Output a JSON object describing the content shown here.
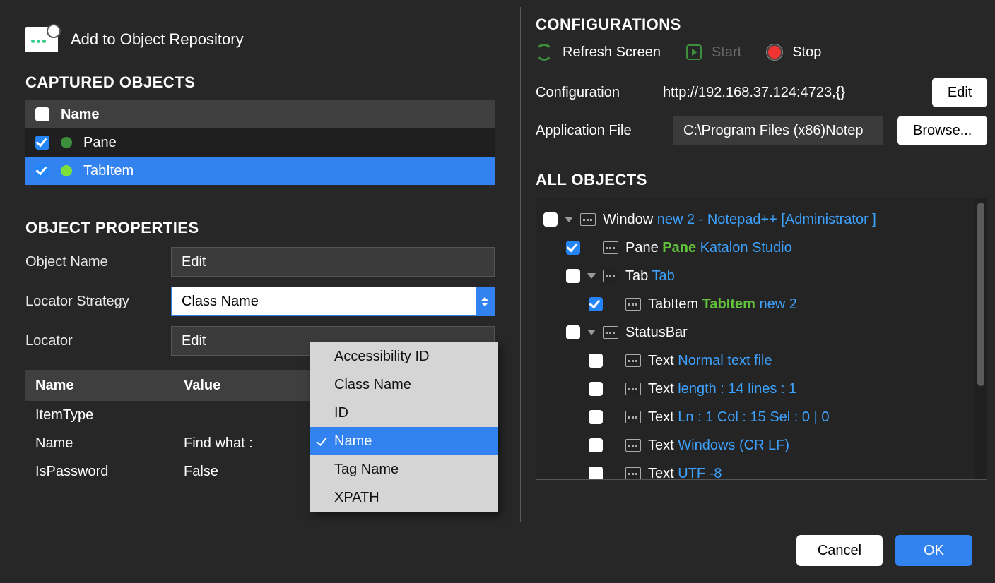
{
  "title": "Add to Object Repository",
  "captured": {
    "heading": "CAPTURED OBJECTS",
    "column": "Name",
    "rows": [
      {
        "label": "Pane"
      },
      {
        "label": "TabItem"
      }
    ]
  },
  "props": {
    "heading": "OBJECT PROPERTIES",
    "objectNameLabel": "Object Name",
    "objectNameValue": "Edit",
    "locatorStrategyLabel": "Locator Strategy",
    "locatorStrategyValue": "Class Name",
    "locatorLabel": "Locator",
    "locatorValue": "Edit",
    "table": {
      "h1": "Name",
      "h2": "Value",
      "rows": [
        {
          "name": "ItemType",
          "value": ""
        },
        {
          "name": "Name",
          "value": "Find what :"
        },
        {
          "name": "IsPassword",
          "value": "False"
        }
      ]
    }
  },
  "dropdown": {
    "items": [
      "Accessibility ID",
      "Class Name",
      "ID",
      "Name",
      "Tag Name",
      "XPATH"
    ],
    "selected": "Name"
  },
  "config": {
    "heading": "CONFIGURATIONS",
    "refresh": "Refresh Screen",
    "start": "Start",
    "stop": "Stop",
    "configurationLabel": "Configuration",
    "configurationValue": "http://192.168.37.124:4723,{}",
    "editBtn": "Edit",
    "appFileLabel": "Application File",
    "appFileValue": "C:\\Program Files (x86)Notep",
    "browseBtn": "Browse..."
  },
  "all": {
    "heading": "ALL OBJECTS",
    "tree": [
      {
        "indent": 0,
        "checked": false,
        "exp": "open",
        "type": "Window",
        "green": "",
        "blue": "new 2 - Notepad++ [Administrator ]"
      },
      {
        "indent": 1,
        "checked": true,
        "exp": "",
        "type": "Pane",
        "green": "Pane",
        "blue": "Katalon Studio"
      },
      {
        "indent": 1,
        "checked": false,
        "exp": "open",
        "type": "Tab",
        "green": "",
        "blue": "Tab"
      },
      {
        "indent": 2,
        "checked": true,
        "exp": "",
        "type": "TabItem",
        "green": "TabItem",
        "blue": "new 2"
      },
      {
        "indent": 1,
        "checked": false,
        "exp": "open",
        "type": "StatusBar",
        "green": "",
        "blue": ""
      },
      {
        "indent": 2,
        "checked": false,
        "exp": "",
        "type": "Text",
        "green": "",
        "blue": "Normal text file"
      },
      {
        "indent": 2,
        "checked": false,
        "exp": "",
        "type": "Text",
        "green": "",
        "blue": "length : 14  lines : 1"
      },
      {
        "indent": 2,
        "checked": false,
        "exp": "",
        "type": "Text",
        "green": "",
        "blue": "Ln : 1  Col : 15   Sel : 0 | 0"
      },
      {
        "indent": 2,
        "checked": false,
        "exp": "",
        "type": "Text",
        "green": "",
        "blue": "Windows (CR LF)"
      },
      {
        "indent": 2,
        "checked": false,
        "exp": "",
        "type": "Text",
        "green": "",
        "blue": "UTF -8"
      }
    ]
  },
  "footer": {
    "cancel": "Cancel",
    "ok": "OK"
  }
}
